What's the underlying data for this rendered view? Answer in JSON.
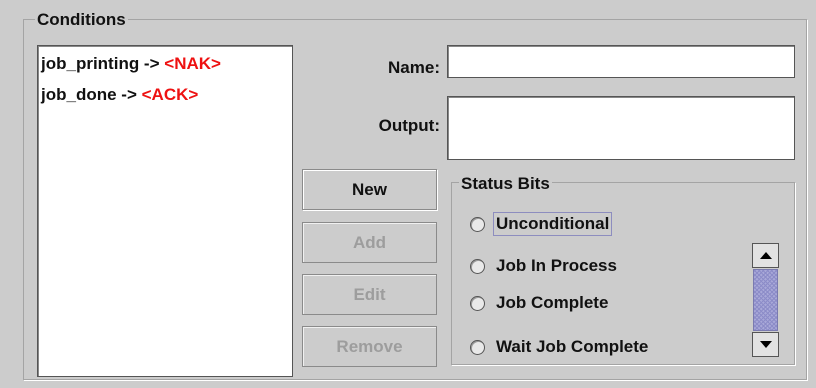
{
  "conditions": {
    "title": "Conditions",
    "items": [
      {
        "trigger": "job_printing ->",
        "response": "<NAK>"
      },
      {
        "trigger": "job_done ->",
        "response": "<ACK>"
      }
    ]
  },
  "form": {
    "name_label": "Name:",
    "name_value": "",
    "output_label": "Output:",
    "output_value": ""
  },
  "buttons": {
    "new": "New",
    "add": "Add",
    "edit": "Edit",
    "remove": "Remove"
  },
  "status_bits": {
    "title": "Status Bits",
    "options": [
      {
        "label": "Unconditional",
        "selected": false
      },
      {
        "label": "Job In Process",
        "selected": false
      },
      {
        "label": "Job Complete",
        "selected": false
      },
      {
        "label": "Wait Job Complete",
        "selected": false
      }
    ]
  },
  "colors": {
    "background": "#cccccc",
    "response_text": "#ee1111",
    "disabled_text": "#9d9d9d",
    "scroll_thumb": "#a8a8d8"
  },
  "icons": {
    "scroll_up": "triangle-up",
    "scroll_down": "triangle-down",
    "radio": "circle-outline"
  }
}
